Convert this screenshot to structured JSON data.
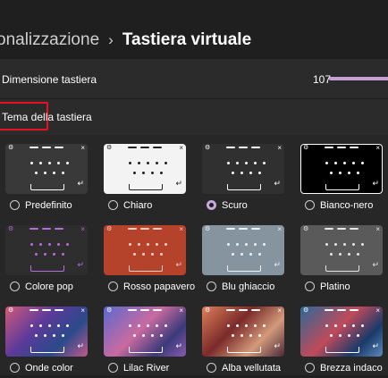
{
  "breadcrumb": {
    "parent": "onalizzazione",
    "separator": "›",
    "current": "Tastiera virtuale"
  },
  "size": {
    "label": "Dimensione tastiera",
    "value": "107"
  },
  "theme_section": {
    "label": "Tema della tastiera"
  },
  "themes": [
    {
      "name": "Predefinito",
      "selected": false,
      "bg": "#393939",
      "fg": "#ffffff",
      "accent": "#ffffff"
    },
    {
      "name": "Chiaro",
      "selected": false,
      "bg": "#f3f3f3",
      "fg": "#222222",
      "accent": "#222222"
    },
    {
      "name": "Scuro",
      "selected": true,
      "bg": "#303030",
      "fg": "#ffffff",
      "accent": "#ffffff"
    },
    {
      "name": "Bianco-nero",
      "selected": false,
      "bg": "#000000",
      "fg": "#ffffff",
      "accent": "#ffffff"
    },
    {
      "name": "Colore pop",
      "selected": false,
      "bg": "#2e2e2e",
      "fg": "#b86dde",
      "accent": "#b86dde"
    },
    {
      "name": "Rosso papavero",
      "selected": false,
      "bg": "#b5422a",
      "fg": "#f5d3c8",
      "accent": "#f5d3c8"
    },
    {
      "name": "Blu ghiaccio",
      "selected": false,
      "bg": "#8694a0",
      "fg": "#eef2f5",
      "accent": "#eef2f5"
    },
    {
      "name": "Platino",
      "selected": false,
      "bg": "#5a5a5a",
      "fg": "#e6e6e6",
      "accent": "#e6e6e6"
    },
    {
      "name": "Onde color",
      "selected": false,
      "bg": "#2a2f6a",
      "fg": "#ffffff",
      "accent": "#ffffff"
    },
    {
      "name": "Lilac River",
      "selected": false,
      "bg": "#3a3c7a",
      "fg": "#ffffff",
      "accent": "#ffffff"
    },
    {
      "name": "Alba vellutata",
      "selected": false,
      "bg": "#7a3a2c",
      "fg": "#ffffff",
      "accent": "#ffffff"
    },
    {
      "name": "Brezza indaco",
      "selected": false,
      "bg": "#243a5e",
      "fg": "#ffffff",
      "accent": "#ffffff"
    }
  ],
  "icons": {
    "gear": "gear-icon",
    "close": "close-icon",
    "enter": "enter-icon"
  }
}
